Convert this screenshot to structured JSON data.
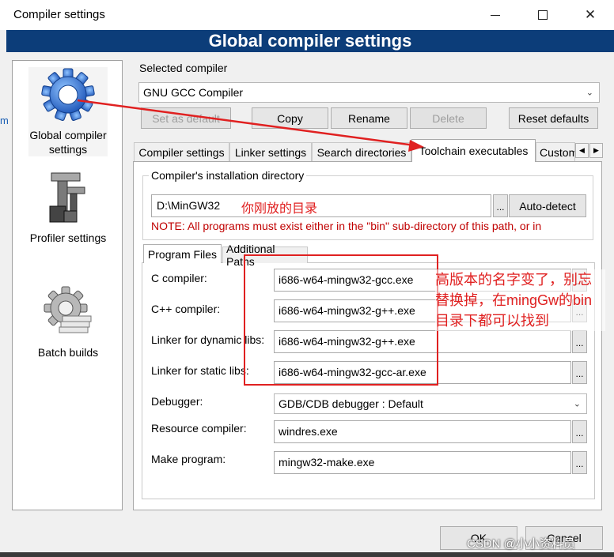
{
  "window": {
    "title": "Compiler settings",
    "minimize": "",
    "maximize": "",
    "close": "✕"
  },
  "banner": "Global compiler settings",
  "sidebar": {
    "items": [
      {
        "label": "Global compiler settings",
        "icon": "gear-icon"
      },
      {
        "label": "Profiler settings",
        "icon": "caliper-icon"
      },
      {
        "label": "Batch builds",
        "icon": "batch-gear-icon"
      }
    ]
  },
  "selected_compiler": {
    "label": "Selected compiler",
    "value": "GNU GCC Compiler"
  },
  "buttons": {
    "set_default": "Set as default",
    "copy": "Copy",
    "rename": "Rename",
    "delete": "Delete",
    "reset_defaults": "Reset defaults",
    "auto_detect": "Auto-detect",
    "ok": "OK",
    "cancel": "Cancel",
    "browse": "..."
  },
  "tabs": [
    {
      "label": "Compiler settings"
    },
    {
      "label": "Linker settings"
    },
    {
      "label": "Search directories"
    },
    {
      "label": "Toolchain executables",
      "active": true
    },
    {
      "label": "Custom build commands"
    }
  ],
  "tab_scroll": {
    "left": "◀",
    "right": "▶"
  },
  "install": {
    "legend": "Compiler's installation directory",
    "value": "D:\\MinGW32",
    "hint": "你刚放的目录",
    "note": "NOTE: All programs must exist either in the \"bin\" sub-directory of this path, or in"
  },
  "inner_tabs": [
    {
      "label": "Program Files",
      "active": true
    },
    {
      "label": "Additional Paths"
    }
  ],
  "programs": {
    "c_compiler": {
      "label": "C compiler:",
      "value": "i686-w64-mingw32-gcc.exe"
    },
    "cpp_compiler": {
      "label": "C++ compiler:",
      "value": "i686-w64-mingw32-g++.exe"
    },
    "dynamic_linker": {
      "label": "Linker for dynamic libs:",
      "value": "i686-w64-mingw32-g++.exe"
    },
    "static_linker": {
      "label": "Linker for static libs:",
      "value": "i686-w64-mingw32-gcc-ar.exe"
    },
    "debugger": {
      "label": "Debugger:",
      "value": "GDB/CDB debugger : Default"
    },
    "resource_compiler": {
      "label": "Resource compiler:",
      "value": "windres.exe"
    },
    "make_program": {
      "label": "Make program:",
      "value": "mingw32-make.exe"
    }
  },
  "annotation": {
    "text": "高版本的名字变了，别忘替换掉，在mingGw的bin目录下都可以找到"
  },
  "watermark": "CSDN @小小资料员",
  "left_edge_char": "m",
  "colors": {
    "banner": "#0c3d79",
    "annotation": "#e02020",
    "note": "#c00000"
  }
}
